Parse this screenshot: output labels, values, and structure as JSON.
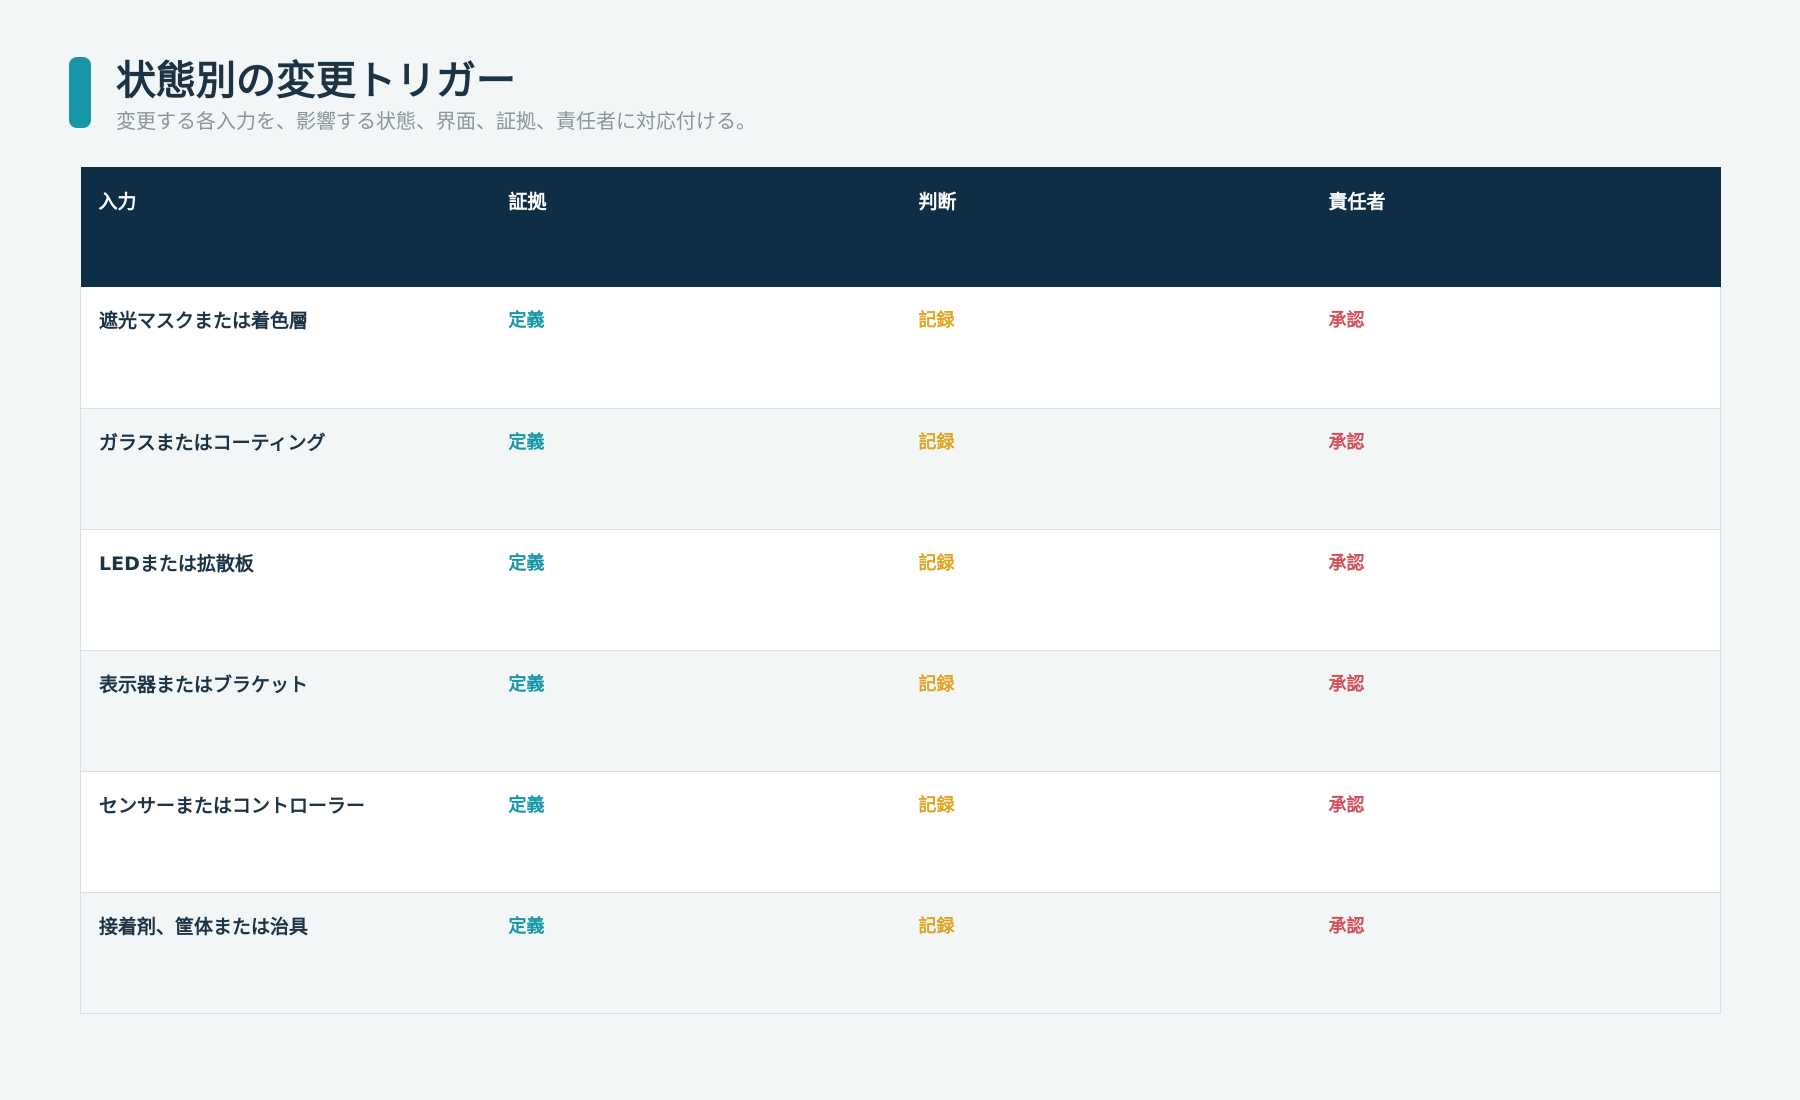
{
  "title": "状態別の変更トリガー",
  "subtitle": "変更する各入力を、影響する状態、界面、証拠、責任者に対応付ける。",
  "colors": {
    "accent": "#1796a6",
    "header_bg": "#0d2e45",
    "evidence": "#1796a6",
    "decision": "#e0a523",
    "owner": "#d2505a"
  },
  "table": {
    "columns": [
      "入力",
      "証拠",
      "判断",
      "責任者"
    ],
    "rows": [
      {
        "input": "遮光マスクまたは着色層",
        "evidence": "定義",
        "decision": "記録",
        "owner": "承認"
      },
      {
        "input": "ガラスまたはコーティング",
        "evidence": "定義",
        "decision": "記録",
        "owner": "承認"
      },
      {
        "input": "LEDまたは拡散板",
        "evidence": "定義",
        "decision": "記録",
        "owner": "承認"
      },
      {
        "input": "表示器またはブラケット",
        "evidence": "定義",
        "decision": "記録",
        "owner": "承認"
      },
      {
        "input": "センサーまたはコントローラー",
        "evidence": "定義",
        "decision": "記録",
        "owner": "承認"
      },
      {
        "input": "接着剤、筐体または治具",
        "evidence": "定義",
        "decision": "記録",
        "owner": "承認"
      }
    ]
  }
}
